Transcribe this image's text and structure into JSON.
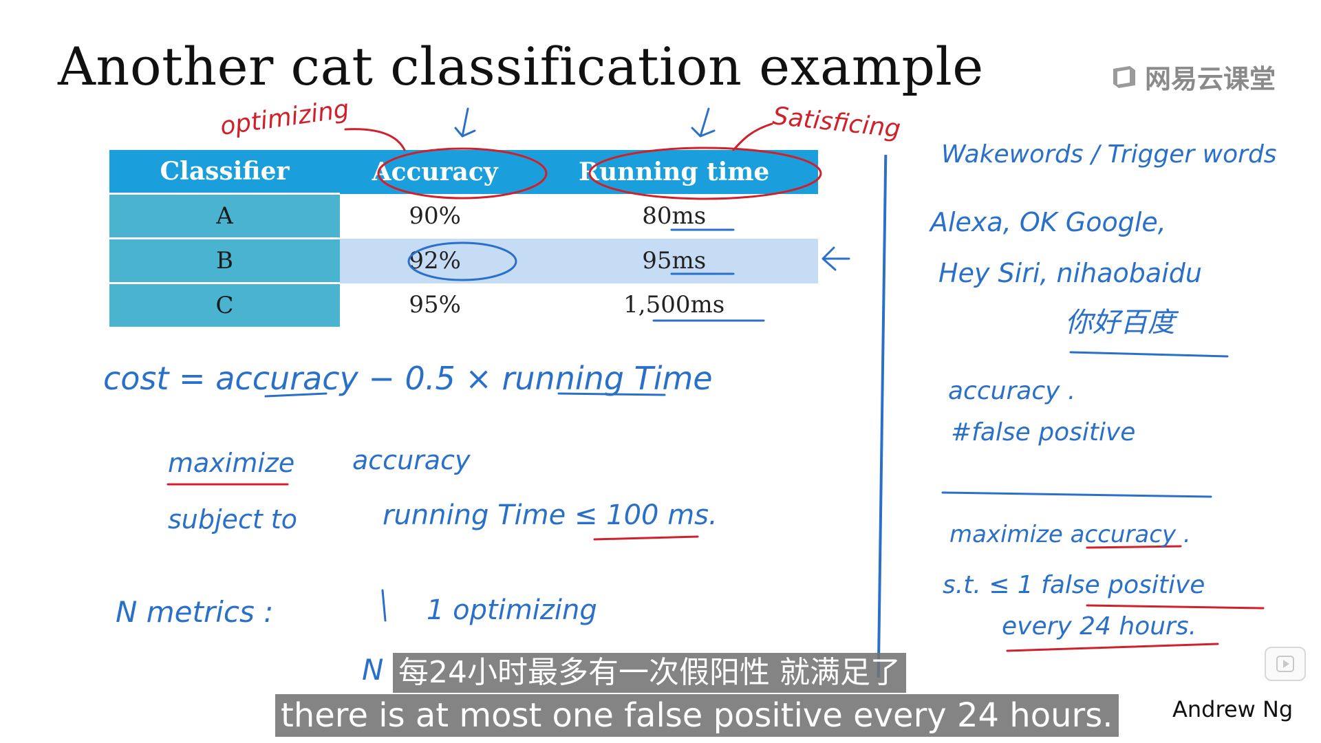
{
  "slide": {
    "title": "Another cat classification example",
    "watermark": "网易云课堂"
  },
  "table": {
    "headers": [
      "Classifier",
      "Accuracy",
      "Running time"
    ],
    "rows": [
      {
        "classifier": "A",
        "accuracy": "90%",
        "running_time": "80ms"
      },
      {
        "classifier": "B",
        "accuracy": "92%",
        "running_time": "95ms"
      },
      {
        "classifier": "C",
        "accuracy": "95%",
        "running_time": "1,500ms"
      }
    ]
  },
  "annotations": {
    "optimizing_label": "optimizing",
    "satisficing_label": "Satisficing",
    "cost_formula": "cost = accuracy − 0.5 × running Time",
    "maximize": "maximize",
    "accuracy_word": "accuracy",
    "subject_to": "subject to",
    "running_time_constraint": "running Time ≤ 100 ms.",
    "n_metrics": "N metrics :",
    "one_optimizing": "1 optimizing",
    "n_minus_one": "N",
    "wakewords": "Wakewords / Trigger words",
    "examples_line1": "Alexa, OK Google,",
    "examples_line2": "Hey Siri, nihaobaidu",
    "examples_line3": "你好百度",
    "accuracy_note": "accuracy .",
    "false_positive": "#false positive",
    "maximize2": "maximize accuracy .",
    "st_line": "s.t. ≤ 1 false positive",
    "every_line": "every 24 hours."
  },
  "subtitles": {
    "chinese": "每24小时最多有一次假阳性 就满足了",
    "english": "there is at most one false positive every 24 hours."
  },
  "author": "Andrew Ng",
  "colors": {
    "header_blue": "#1a9fdc",
    "classifier_cell": "#4ab3cf",
    "selected_row": "#c6dbf4",
    "ink_blue": "#2a6fc8",
    "ink_red": "#d0202a"
  }
}
